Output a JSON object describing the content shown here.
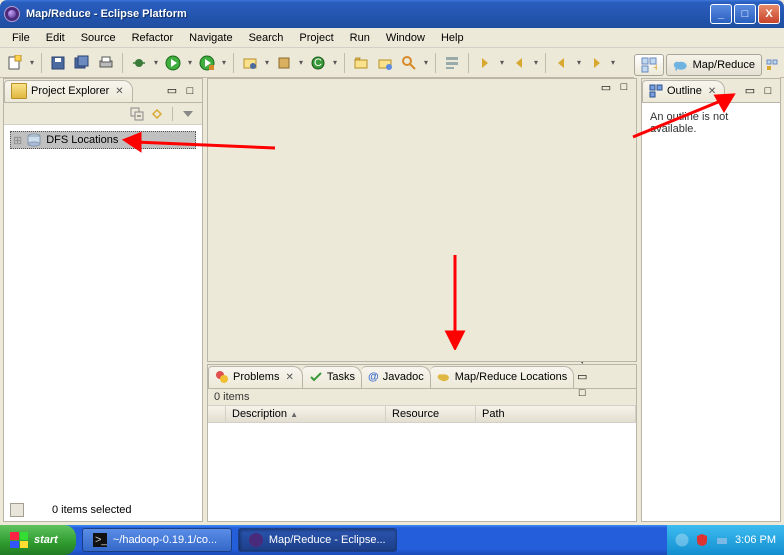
{
  "window": {
    "title": "Map/Reduce - Eclipse Platform"
  },
  "menubar": {
    "items": [
      "File",
      "Edit",
      "Source",
      "Refactor",
      "Navigate",
      "Search",
      "Project",
      "Run",
      "Window",
      "Help"
    ]
  },
  "perspective": {
    "active_label": "Map/Reduce"
  },
  "views": {
    "project_explorer": {
      "title": "Project Explorer",
      "tree": {
        "root_label": "DFS Locations"
      }
    },
    "outline": {
      "title": "Outline",
      "empty_msg": "An outline is not available."
    }
  },
  "bottom_tabs": {
    "problems": "Problems",
    "tasks": "Tasks",
    "javadoc": "Javadoc",
    "mapreduce_locations": "Map/Reduce Locations",
    "items_count": "0 items",
    "columns": {
      "description": "Description",
      "resource": "Resource",
      "path": "Path"
    }
  },
  "statusbar": {
    "selection": "0 items selected"
  },
  "taskbar": {
    "start": "start",
    "btn1": "~/hadoop-0.19.1/co...",
    "btn2": "Map/Reduce - Eclipse...",
    "clock": "3:06 PM"
  },
  "colors": {
    "xp_blue": "#245edb",
    "xp_green": "#2f9a2f",
    "accent_red": "#ff0000"
  }
}
